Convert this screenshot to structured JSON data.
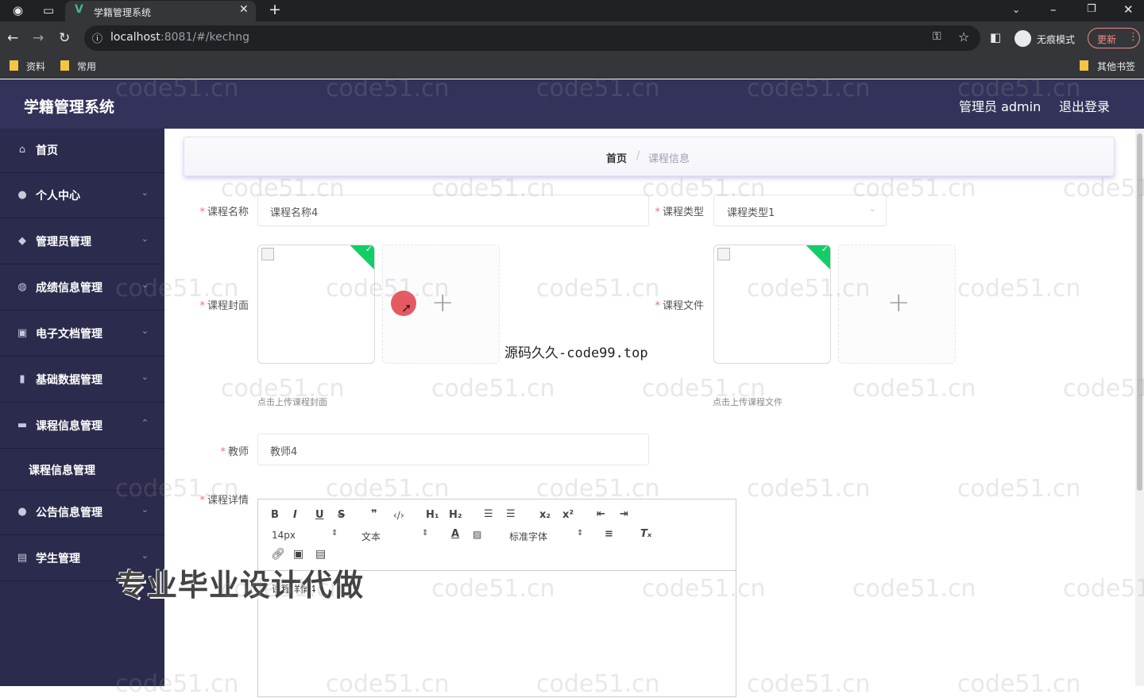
{
  "browser": {
    "tab_title": "学籍管理系统",
    "url_host": "localhost",
    "url_rest": ":8081/#/kechng",
    "incognito_label": "无痕模式",
    "update_label": "更新",
    "bookmarks": [
      "资料",
      "常用"
    ],
    "other_bookmarks": "其他书签"
  },
  "app": {
    "title": "学籍管理系统",
    "user_label": "管理员 admin",
    "logout_label": "退出登录"
  },
  "sidebar": {
    "items": [
      {
        "label": "首页",
        "icon": "home-icon",
        "glyph": "⌂",
        "expandable": false
      },
      {
        "label": "个人中心",
        "icon": "user-icon",
        "glyph": "●",
        "expandable": true
      },
      {
        "label": "管理员管理",
        "icon": "location-icon",
        "glyph": "◆",
        "expandable": true
      },
      {
        "label": "成绩信息管理",
        "icon": "microphone-icon",
        "glyph": "◍",
        "expandable": true
      },
      {
        "label": "电子文档管理",
        "icon": "document-icon",
        "glyph": "▣",
        "expandable": true
      },
      {
        "label": "基础数据管理",
        "icon": "bar-chart-icon",
        "glyph": "▮",
        "expandable": true
      },
      {
        "label": "课程信息管理",
        "icon": "chat-icon",
        "glyph": "▬",
        "expandable": true,
        "expanded": true
      },
      {
        "label": "公告信息管理",
        "icon": "user-icon",
        "glyph": "●",
        "expandable": true
      },
      {
        "label": "学生管理",
        "icon": "briefcase-icon",
        "glyph": "▤",
        "expandable": true
      }
    ],
    "submenu_label": "课程信息管理"
  },
  "breadcrumb": {
    "home": "首页",
    "separator": "/",
    "current": "课程信息"
  },
  "form": {
    "course_name_label": "课程名称",
    "course_name_value": "课程名称4",
    "course_type_label": "课程类型",
    "course_type_value": "课程类型1",
    "cover_label": "课程封面",
    "cover_hint": "点击上传课程封面",
    "file_label": "课程文件",
    "file_hint": "点击上传课程文件",
    "teacher_label": "教师",
    "teacher_value": "教师4",
    "detail_label": "课程详情",
    "detail_value": "课程详情4"
  },
  "editor": {
    "font_size": "14px",
    "paragraph": "文本",
    "font_family": "标准字体"
  },
  "overlays": {
    "watermark": "code51.cn",
    "source_text": "源码久久-code99.top",
    "promo_text": "专业毕业设计代做"
  },
  "colors": {
    "header_bg": "#32325a",
    "sidebar_bg": "#2b2b4d",
    "required": "#f56c6c",
    "success": "#13ce66"
  }
}
